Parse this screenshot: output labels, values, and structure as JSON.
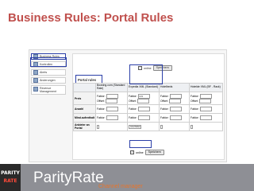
{
  "slide": {
    "title": "Business Rules: Portal Rules"
  },
  "sidebar": {
    "items": [
      {
        "label": "Business Rules",
        "active": true
      },
      {
        "label": "Kontrollen",
        "active": false
      },
      {
        "label": "Alerts",
        "active": false
      },
      {
        "label": "Änderungen",
        "active": false
      },
      {
        "label": "Revenue Management",
        "active": false
      }
    ]
  },
  "panel": {
    "title": "Portal rules",
    "online_label": "online",
    "save_label": "Speichern"
  },
  "table": {
    "columns": [
      "",
      "Booking.com (Standard Rate)",
      "Expedia XML (Standard)",
      "Hotelbeds",
      "Hotelde XML (BF - Rack)"
    ],
    "rows": [
      {
        "label": "Preis",
        "cells": [
          {
            "f1": "Faktor:",
            "v1": "",
            "f2": "Offset:",
            "v2": ""
          },
          {
            "f1": "Faktor:",
            "v1": "0.9",
            "f2": "Offset:",
            "v2": ""
          },
          {
            "f1": "Faktor:",
            "v1": "",
            "f2": "Offset:",
            "v2": ""
          },
          {
            "f1": "Faktor:",
            "v1": "",
            "f2": "Offset:",
            "v2": ""
          }
        ]
      },
      {
        "label": "Anzahl",
        "cells": [
          {
            "f1": "Faktor:",
            "v1": ""
          },
          {
            "f1": "Faktor:",
            "v1": ""
          },
          {
            "f1": "Faktor:",
            "v1": ""
          },
          {
            "f1": "Faktor:",
            "v1": ""
          }
        ]
      },
      {
        "label": "Mind.aufenthalt",
        "cells": [
          {
            "f1": "Faktor:",
            "v1": ""
          },
          {
            "f1": "Faktor:",
            "v1": ""
          },
          {
            "f1": "Faktor:",
            "v1": ""
          },
          {
            "f1": "Faktor:",
            "v1": ""
          }
        ]
      },
      {
        "label": "Anbieter an Portal",
        "cells": [
          {
            "sel": ""
          },
          {
            "sel": "Anschalten"
          },
          {
            "sel": ""
          },
          {
            "sel": ""
          }
        ]
      }
    ]
  },
  "footer": {
    "logo_line1": "PARITY",
    "logo_line2": "RATE",
    "brand": "ParityRate",
    "tagline": "Channel manager"
  }
}
